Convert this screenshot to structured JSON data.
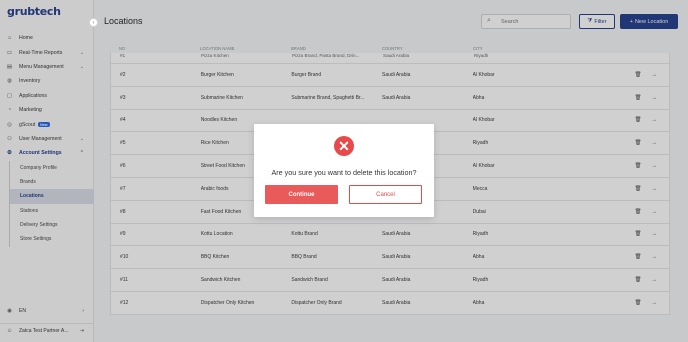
{
  "app": {
    "logo": "grubtech"
  },
  "sidebar": {
    "items": [
      {
        "label": "Home",
        "icon": "home-icon"
      },
      {
        "label": "Real-Time Reports",
        "icon": "reports-icon",
        "chevron": "⌄"
      },
      {
        "label": "Menu Management",
        "icon": "menu-icon",
        "chevron": "⌄"
      },
      {
        "label": "Inventory",
        "icon": "inventory-icon"
      },
      {
        "label": "Applications",
        "icon": "applications-icon"
      },
      {
        "label": "Marketing",
        "icon": "marketing-icon"
      },
      {
        "label": "gScout",
        "icon": "gscout-icon",
        "badge": "New"
      },
      {
        "label": "User Management",
        "icon": "users-icon",
        "chevron": "⌄"
      },
      {
        "label": "Account Settings",
        "icon": "settings-icon",
        "chevron": "⌃"
      }
    ],
    "sub_items": [
      "Company Profile",
      "Brands",
      "Locations",
      "Stations",
      "Delivery Settings",
      "Store Settings"
    ],
    "selected_sub": "Locations",
    "language": "EN",
    "user": "Zatca Test Partner A..."
  },
  "header": {
    "title": "Locations",
    "search_placeholder": "Search",
    "filter_label": "Filter",
    "new_location_label": "New Location"
  },
  "table": {
    "columns": [
      "NO",
      "LOCATION NAME",
      "BRAND",
      "COUNTRY",
      "CITY"
    ],
    "first_row": [
      "#1",
      "Pizza Kitchen",
      "Pizza Brand, Pasta Brand, Drin...",
      "Saudi Arabia",
      "Riyadh"
    ],
    "rows": [
      [
        "#2",
        "Burger Kitchen",
        "Burger Brand",
        "Saudi Arabia",
        "Al Khobar"
      ],
      [
        "#3",
        "Submarine Kitchen",
        "Submarine Brand, Spaghetti Br...",
        "Saudi Arabia",
        "Abha"
      ],
      [
        "#4",
        "Noodles Kitchen",
        "",
        "",
        "Al Khobar"
      ],
      [
        "#5",
        "Rice Kitchen",
        "",
        "",
        "Riyadh"
      ],
      [
        "#6",
        "Street Food Kitchen",
        "",
        "",
        "Al Khobar"
      ],
      [
        "#7",
        "Arabic foods",
        "",
        "",
        "Mecca"
      ],
      [
        "#8",
        "Fast Food Kitchen",
        "Fast Food Brand",
        "United Arab Emirates",
        "Dubai"
      ],
      [
        "#9",
        "Kottu Location",
        "Kottu Brand",
        "Saudi Arabia",
        "Riyadh"
      ],
      [
        "#10",
        "BBQ Kitchen",
        "BBQ Brand",
        "Saudi Arabia",
        "Abha"
      ],
      [
        "#11",
        "Sandwich Kitchen",
        "Sandwich Brand",
        "Saudi Arabia",
        "Riyadh"
      ],
      [
        "#12",
        "Dispatcher Only Kitchen",
        "Dispatcher Only Brand",
        "Saudi Arabia",
        "Abha"
      ]
    ]
  },
  "modal": {
    "message": "Are you sure you want to delete this location?",
    "continue_label": "Continue",
    "cancel_label": "Cancel",
    "icon": "close-circle-icon"
  },
  "colors": {
    "primary": "#1e3a8a",
    "danger": "#e84a4a"
  }
}
